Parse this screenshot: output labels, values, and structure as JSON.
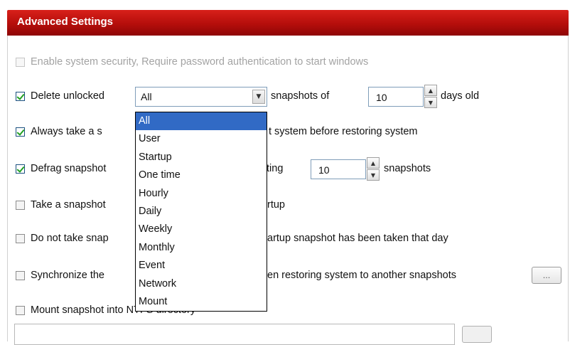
{
  "header": {
    "title": "Advanced Settings"
  },
  "options": {
    "enable_security": {
      "label": "Enable system security, Require password authentication to start windows",
      "checked": false,
      "enabled": false
    },
    "delete_unlocked": {
      "label_pre": "Delete unlocked",
      "label_mid": "snapshots of",
      "label_post": "days old",
      "checked": true,
      "type_value": "All",
      "days": "10"
    },
    "always_take": {
      "label": "Always take a s",
      "label_tail": "t system before restoring system",
      "checked": true
    },
    "defrag": {
      "label": "Defrag snapshot",
      "label_mid": "ting",
      "label_post": "snapshots",
      "checked": true,
      "count": "10"
    },
    "take_startup": {
      "label": "Take a snapshot",
      "label_tail": "rtup",
      "checked": false
    },
    "do_not_take": {
      "label": "Do not take snap",
      "label_tail": "artup snapshot has been taken that day",
      "checked": false
    },
    "synchronize": {
      "label": "Synchronize the",
      "label_tail": "en restoring system to another snapshots",
      "checked": false,
      "browse_label": "..."
    },
    "mount": {
      "label": "Mount snapshot into NTFS directory",
      "checked": false
    }
  },
  "dropdown": {
    "items": [
      "All",
      "User",
      "Startup",
      "One time",
      "Hourly",
      "Daily",
      "Weekly",
      "Monthly",
      "Event",
      "Network",
      "Mount"
    ],
    "selected": "All"
  },
  "icons": {
    "combo": "chevron-down-icon",
    "spin_up": "triangle-up-icon",
    "spin_down": "triangle-down-icon",
    "check": "checkmark-icon"
  },
  "colors": {
    "header_red": "#b50e0b",
    "selection_blue": "#316ac5",
    "check_green": "#21a121"
  }
}
